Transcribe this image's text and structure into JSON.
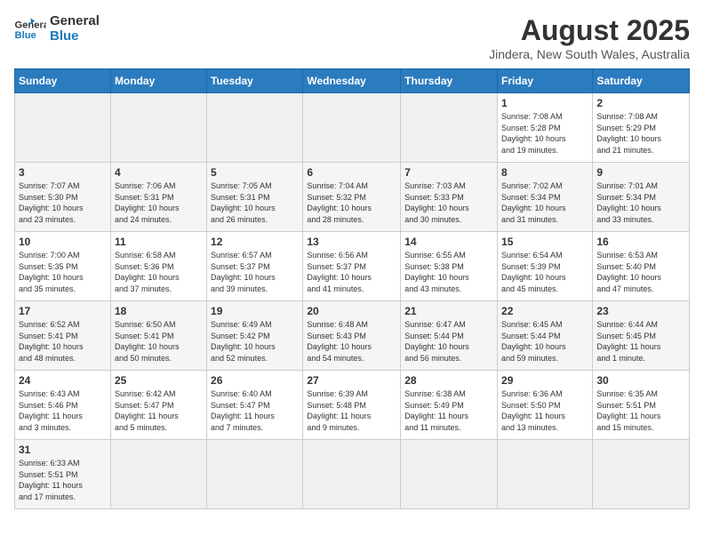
{
  "header": {
    "logo_general": "General",
    "logo_blue": "Blue",
    "month_title": "August 2025",
    "location": "Jindera, New South Wales, Australia"
  },
  "days_of_week": [
    "Sunday",
    "Monday",
    "Tuesday",
    "Wednesday",
    "Thursday",
    "Friday",
    "Saturday"
  ],
  "weeks": [
    [
      {
        "day": "",
        "info": ""
      },
      {
        "day": "",
        "info": ""
      },
      {
        "day": "",
        "info": ""
      },
      {
        "day": "",
        "info": ""
      },
      {
        "day": "",
        "info": ""
      },
      {
        "day": "1",
        "info": "Sunrise: 7:08 AM\nSunset: 5:28 PM\nDaylight: 10 hours\nand 19 minutes."
      },
      {
        "day": "2",
        "info": "Sunrise: 7:08 AM\nSunset: 5:29 PM\nDaylight: 10 hours\nand 21 minutes."
      }
    ],
    [
      {
        "day": "3",
        "info": "Sunrise: 7:07 AM\nSunset: 5:30 PM\nDaylight: 10 hours\nand 23 minutes."
      },
      {
        "day": "4",
        "info": "Sunrise: 7:06 AM\nSunset: 5:31 PM\nDaylight: 10 hours\nand 24 minutes."
      },
      {
        "day": "5",
        "info": "Sunrise: 7:05 AM\nSunset: 5:31 PM\nDaylight: 10 hours\nand 26 minutes."
      },
      {
        "day": "6",
        "info": "Sunrise: 7:04 AM\nSunset: 5:32 PM\nDaylight: 10 hours\nand 28 minutes."
      },
      {
        "day": "7",
        "info": "Sunrise: 7:03 AM\nSunset: 5:33 PM\nDaylight: 10 hours\nand 30 minutes."
      },
      {
        "day": "8",
        "info": "Sunrise: 7:02 AM\nSunset: 5:34 PM\nDaylight: 10 hours\nand 31 minutes."
      },
      {
        "day": "9",
        "info": "Sunrise: 7:01 AM\nSunset: 5:34 PM\nDaylight: 10 hours\nand 33 minutes."
      }
    ],
    [
      {
        "day": "10",
        "info": "Sunrise: 7:00 AM\nSunset: 5:35 PM\nDaylight: 10 hours\nand 35 minutes."
      },
      {
        "day": "11",
        "info": "Sunrise: 6:58 AM\nSunset: 5:36 PM\nDaylight: 10 hours\nand 37 minutes."
      },
      {
        "day": "12",
        "info": "Sunrise: 6:57 AM\nSunset: 5:37 PM\nDaylight: 10 hours\nand 39 minutes."
      },
      {
        "day": "13",
        "info": "Sunrise: 6:56 AM\nSunset: 5:37 PM\nDaylight: 10 hours\nand 41 minutes."
      },
      {
        "day": "14",
        "info": "Sunrise: 6:55 AM\nSunset: 5:38 PM\nDaylight: 10 hours\nand 43 minutes."
      },
      {
        "day": "15",
        "info": "Sunrise: 6:54 AM\nSunset: 5:39 PM\nDaylight: 10 hours\nand 45 minutes."
      },
      {
        "day": "16",
        "info": "Sunrise: 6:53 AM\nSunset: 5:40 PM\nDaylight: 10 hours\nand 47 minutes."
      }
    ],
    [
      {
        "day": "17",
        "info": "Sunrise: 6:52 AM\nSunset: 5:41 PM\nDaylight: 10 hours\nand 48 minutes."
      },
      {
        "day": "18",
        "info": "Sunrise: 6:50 AM\nSunset: 5:41 PM\nDaylight: 10 hours\nand 50 minutes."
      },
      {
        "day": "19",
        "info": "Sunrise: 6:49 AM\nSunset: 5:42 PM\nDaylight: 10 hours\nand 52 minutes."
      },
      {
        "day": "20",
        "info": "Sunrise: 6:48 AM\nSunset: 5:43 PM\nDaylight: 10 hours\nand 54 minutes."
      },
      {
        "day": "21",
        "info": "Sunrise: 6:47 AM\nSunset: 5:44 PM\nDaylight: 10 hours\nand 56 minutes."
      },
      {
        "day": "22",
        "info": "Sunrise: 6:45 AM\nSunset: 5:44 PM\nDaylight: 10 hours\nand 59 minutes."
      },
      {
        "day": "23",
        "info": "Sunrise: 6:44 AM\nSunset: 5:45 PM\nDaylight: 11 hours\nand 1 minute."
      }
    ],
    [
      {
        "day": "24",
        "info": "Sunrise: 6:43 AM\nSunset: 5:46 PM\nDaylight: 11 hours\nand 3 minutes."
      },
      {
        "day": "25",
        "info": "Sunrise: 6:42 AM\nSunset: 5:47 PM\nDaylight: 11 hours\nand 5 minutes."
      },
      {
        "day": "26",
        "info": "Sunrise: 6:40 AM\nSunset: 5:47 PM\nDaylight: 11 hours\nand 7 minutes."
      },
      {
        "day": "27",
        "info": "Sunrise: 6:39 AM\nSunset: 5:48 PM\nDaylight: 11 hours\nand 9 minutes."
      },
      {
        "day": "28",
        "info": "Sunrise: 6:38 AM\nSunset: 5:49 PM\nDaylight: 11 hours\nand 11 minutes."
      },
      {
        "day": "29",
        "info": "Sunrise: 6:36 AM\nSunset: 5:50 PM\nDaylight: 11 hours\nand 13 minutes."
      },
      {
        "day": "30",
        "info": "Sunrise: 6:35 AM\nSunset: 5:51 PM\nDaylight: 11 hours\nand 15 minutes."
      }
    ],
    [
      {
        "day": "31",
        "info": "Sunrise: 6:33 AM\nSunset: 5:51 PM\nDaylight: 11 hours\nand 17 minutes."
      },
      {
        "day": "",
        "info": ""
      },
      {
        "day": "",
        "info": ""
      },
      {
        "day": "",
        "info": ""
      },
      {
        "day": "",
        "info": ""
      },
      {
        "day": "",
        "info": ""
      },
      {
        "day": "",
        "info": ""
      }
    ]
  ]
}
